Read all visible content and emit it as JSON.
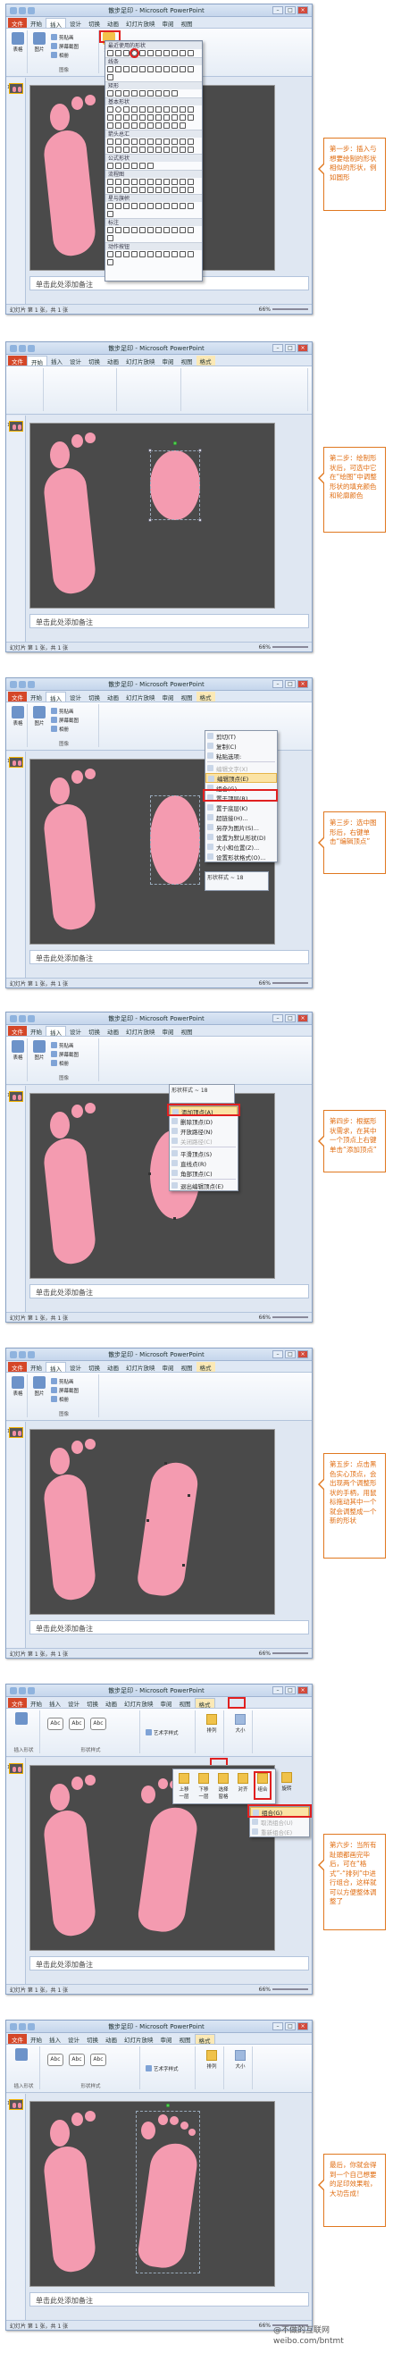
{
  "window": {
    "title": "散步足印 - Microsoft PowerPoint",
    "tabs": [
      "文件",
      "开始",
      "插入",
      "设计",
      "切换",
      "动画",
      "幻灯片放映",
      "审阅",
      "视图",
      "格式"
    ],
    "notes_placeholder": "单击此处添加备注",
    "status_left": "幻灯片 第 1 张，共 1 张",
    "zoom": "66%"
  },
  "steps": [
    {
      "label": "第一步：",
      "text": "插入与想要绘制的形状相似的形状，例如圆形"
    },
    {
      "label": "第二步：",
      "text": "绘制形状后，可选中它在“绘图”中调整形状的填充颜色和轮廓颜色"
    },
    {
      "label": "第三步：",
      "text": "选中图形后，右键单击“编辑顶点”"
    },
    {
      "label": "第四步：",
      "text": "根据形状需求，在其中一个顶点上右键单击“添加顶点”"
    },
    {
      "label": "第五步：",
      "text": "点击黑色实心顶点，会出现两个调整形状的手柄，用鼠标拖动其中一个就会调整成一个新的形状"
    },
    {
      "label": "第六步：",
      "text": "当所有趾頭都画完毕后，可在“格式”-“排列”中进行组合，这样就可以方便整体调整了"
    },
    {
      "label": "最后，",
      "text": "你就会得到一个自己想要的足印效果啦，大功告成！"
    }
  ],
  "panel1": {
    "ribbon": {
      "picture": "图片",
      "clipart": "剪贴画",
      "screenshot": "屏幕截图",
      "album": "相册",
      "shapes": "形状",
      "table": "表格",
      "images_group": "图像"
    },
    "gallery": {
      "recent": "最近使用的形状",
      "lines": "线条",
      "rect": "矩形",
      "basic": "基本形状",
      "arrows": "箭头总汇",
      "formula": "公式形状",
      "flowchart": "流程图",
      "stars": "星与旗帜",
      "callouts": "标注",
      "action": "动作按钮"
    }
  },
  "panel3": {
    "menu": [
      "剪切(T)",
      "复制(C)",
      "粘贴选项:",
      "编辑文字(X)",
      "编辑顶点(E)",
      "组合(G)",
      "置于顶层(R)",
      "置于底层(K)",
      "超链接(H)...",
      "另存为图片(S)...",
      "设置为默认形状(D)",
      "大小和位置(Z)...",
      "设置形状格式(O)..."
    ],
    "mini_style": "形状样式 ~ 18"
  },
  "panel4": {
    "menu": [
      "添加顶点(A)",
      "删除顶点(D)",
      "开放路径(N)",
      "关闭路径(C)",
      "平滑顶点(S)",
      "直线点(R)",
      "角部顶点(C)",
      "退出编辑顶点(E)"
    ],
    "mini_style": "形状样式 ~ 18"
  },
  "panel6": {
    "ribbon": {
      "insert_shapes": "插入形状",
      "shape_styles": "形状样式",
      "art_styles": "艺术字样式",
      "arrange": "排列",
      "size": "大小",
      "bring_forward": "上移一层",
      "send_backward": "下移一层",
      "selection_pane": "选择窗格",
      "align": "对齐",
      "group": "组合",
      "rotate": "旋转"
    },
    "group_menu": [
      "组合(G)",
      "取消组合(U)",
      "重新组合(E)"
    ],
    "abc": "Abc"
  },
  "watermark": "@不做的互联网\nweibo.com/bntmt"
}
